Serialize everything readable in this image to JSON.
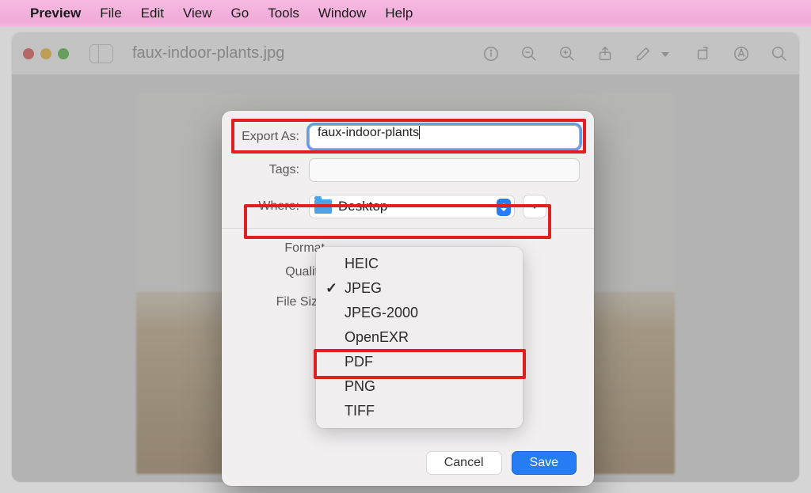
{
  "menubar": {
    "app_name": "Preview",
    "items": [
      "File",
      "Edit",
      "View",
      "Go",
      "Tools",
      "Window",
      "Help"
    ]
  },
  "window": {
    "document_title": "faux-indoor-plants.jpg"
  },
  "export_dialog": {
    "export_as_label": "Export As:",
    "export_as_value": "faux-indoor-plants",
    "tags_label": "Tags:",
    "tags_value": "",
    "where_label": "Where:",
    "where_value": "Desktop",
    "format_label": "Format",
    "quality_label": "Quality",
    "file_size_label": "File Size",
    "buttons": {
      "cancel": "Cancel",
      "save": "Save"
    }
  },
  "format_menu": {
    "selected": "JPEG",
    "options": [
      "HEIC",
      "JPEG",
      "JPEG-2000",
      "OpenEXR",
      "PDF",
      "PNG",
      "TIFF"
    ]
  }
}
